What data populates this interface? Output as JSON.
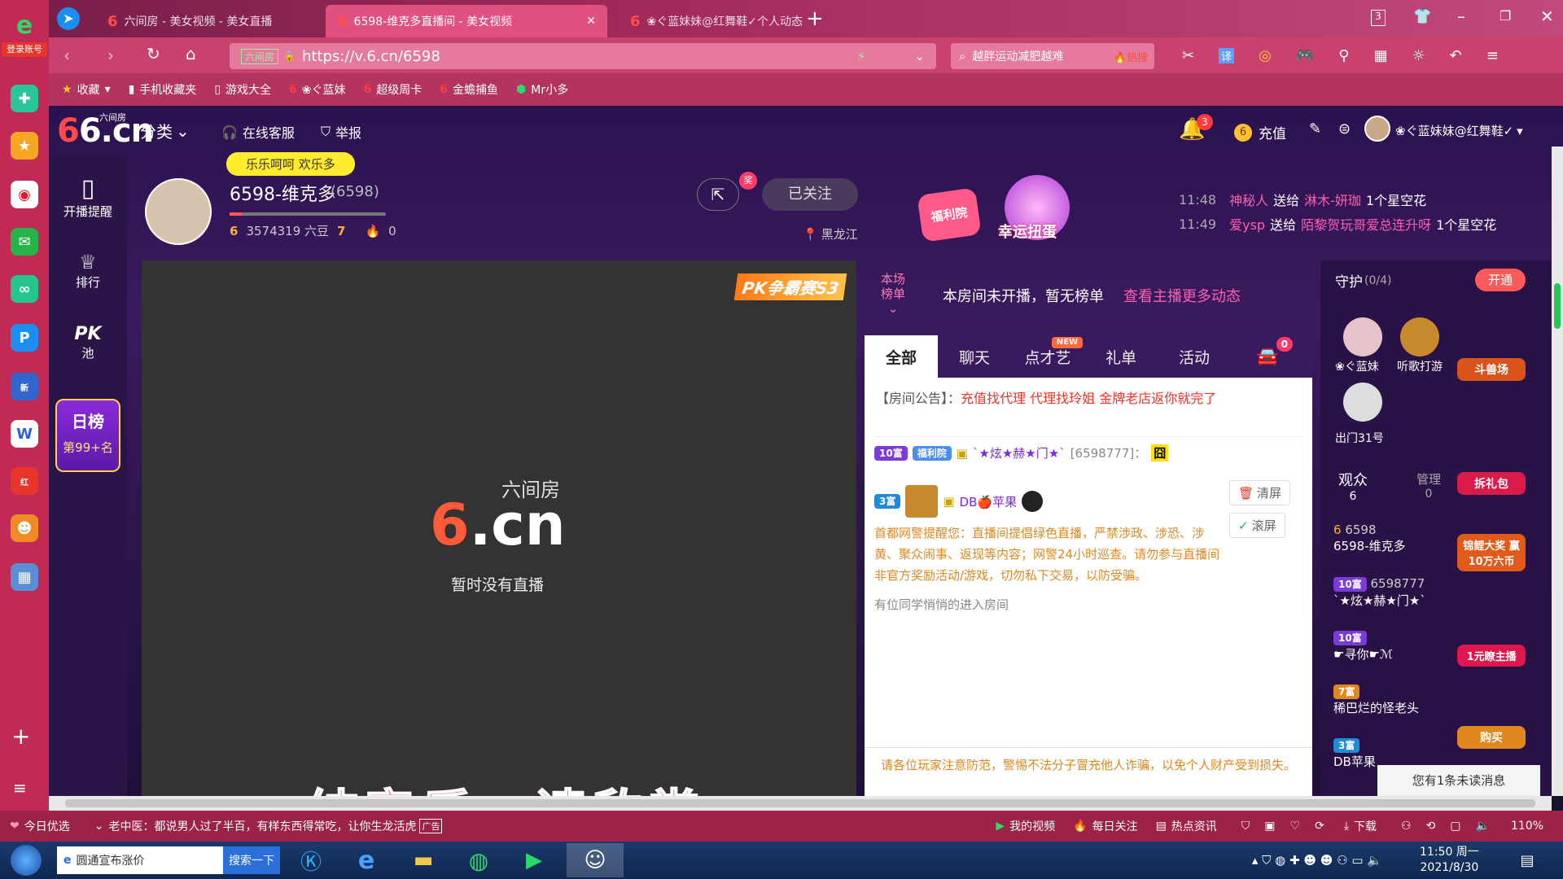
{
  "browser": {
    "login_label": "登录账号",
    "tabs": [
      {
        "label": "六间房 - 美女视频 - 美女直播"
      },
      {
        "label": "6598-维克多直播间 - 美女视频"
      },
      {
        "label": "❀ぐ蓝妹妹@红舞鞋✓个人动态"
      }
    ],
    "tab_count": "3",
    "url": "https://v.6.cn/6598",
    "url_site_tag": "六间房",
    "search_text": "越胖运动减肥越难",
    "search_hot": "🔥热搜",
    "bookmarks": [
      "收藏",
      "手机收藏夹",
      "游戏大全",
      "❀ぐ蓝妹",
      "超级周卡",
      "金蟾捕鱼",
      "Mr小多"
    ]
  },
  "site": {
    "logo_text": "6.cn",
    "logo_sub": "六间房",
    "category": "分类",
    "service": "在线客服",
    "report": "举报",
    "notification_count": "3",
    "recharge": "充值",
    "username": "❀ぐ蓝妹妹@红舞鞋✓"
  },
  "left_nav": {
    "remind": "开播提醒",
    "rank": "排行",
    "pk": "PK",
    "pk_pool": "池",
    "daily": "日榜",
    "daily_rank": "第99+名"
  },
  "host": {
    "bubble": "乐乐呵呵 欢乐多",
    "name": "6598-维克多",
    "room_id": "(6598)",
    "level_left": "6",
    "beans": "3574319 六豆",
    "level_right": "7",
    "fire_count": "0",
    "follow": "已关注",
    "share_badge": "奖",
    "location": "黑龙江",
    "welfare": "福利院",
    "lucky": "幸运扭蛋"
  },
  "gifts_ticker": [
    {
      "time": "11:48",
      "from": "神秘人",
      "verb": "送给",
      "to": "淋木-妍珈",
      "item": "1个星空花"
    },
    {
      "time": "11:49",
      "from": "爱ysp",
      "verb": "送给",
      "to": "陌黎贺玩哥爱总连升呀",
      "item": "1个星空花"
    }
  ],
  "video": {
    "pk_banner": "PK争霸赛S3",
    "logo_text": ".cn",
    "logo_sub": "六间房",
    "offline": "暂时没有直播",
    "subtitle": "纯音乐，请欣赏"
  },
  "rank_strip": {
    "label_line1": "本场",
    "label_line2": "榜单",
    "text": "本房间未开播，暂无榜单",
    "link": "查看主播更多动态"
  },
  "chat": {
    "tabs": [
      "全部",
      "聊天",
      "点才艺",
      "礼单",
      "活动"
    ],
    "new_tag": "NEW",
    "car_count": "0",
    "notice_label": "【房间公告】：",
    "notice_text": "充值找代理 代理找玲姐 金牌老店返你就完了",
    "msg1_badge": "10富",
    "msg1_tag": "福利院",
    "msg1_name": "`★炫★赫★门★`",
    "msg1_id": "[6598777]：",
    "msg2_badge": "3富",
    "msg2_name": "DB🍎苹果",
    "clear": "清屏",
    "scroll": "滚屏",
    "police": "首都网警提醒您：直播间提倡绿色直播，严禁涉政、涉恐、涉黄、聚众闹事、返现等内容；网警24小时巡查。请勿参与直播间非官方奖励活动/游戏，切勿私下交易，以防受骗。",
    "enter": "有位同学悄悄的进入房间",
    "footer_warning": "请各位玩家注意防范，警惕不法分子冒充他人诈骗，以免个人财产受到损失。"
  },
  "guard": {
    "title": "守护",
    "count": "(0/4)",
    "open": "开通",
    "guards": [
      "❀ぐ蓝妹",
      "听歌打游",
      "出门31号"
    ],
    "audience_label": "观众",
    "audience_count": "6",
    "manage_label": "管理",
    "manage_count": "0",
    "viewers": [
      {
        "badge": "6",
        "id": "6598",
        "name": "6598-维克多"
      },
      {
        "badge": "10富",
        "id": "6598777",
        "name": "`★炫★赫★门★`"
      },
      {
        "badge": "10富",
        "id": "",
        "name": "☛寻你☛ℳ"
      },
      {
        "badge": "7富",
        "id": "",
        "name": "稀巴烂的怪老头"
      },
      {
        "badge": "3富",
        "id": "",
        "name": "DB苹果"
      }
    ],
    "promos": [
      "斗兽场",
      "拆礼包",
      "锦鲤大奖 赢10万六币",
      "1元瞭主播",
      "购买"
    ],
    "unread": "您有1条未读消息"
  },
  "statusbar": {
    "today": "今日优选",
    "news": "老中医：都说男人过了半百，有样东西得常吃，让你生龙活虎",
    "ad": "广告",
    "my_video": "我的视频",
    "daily_follow": "每日关注",
    "hot_news": "热点资讯",
    "download": "下载",
    "zoom": "110%"
  },
  "taskbar": {
    "search_title": "圆通宣布涨价",
    "search_btn": "搜索一下",
    "time": "11:50 周一",
    "date": "2021/8/30"
  },
  "colors": {
    "accent": "#e0517f",
    "chat_red": "#e8352b",
    "link_pink": "#ff5fae"
  }
}
